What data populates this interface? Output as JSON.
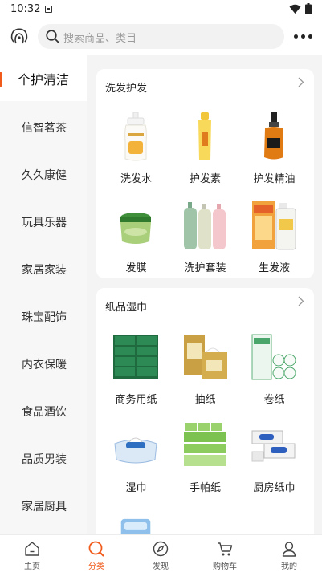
{
  "status": {
    "time": "10:32"
  },
  "search": {
    "placeholder": "搜索商品、类目"
  },
  "sidebar": {
    "items": [
      {
        "label": "个护清洁"
      },
      {
        "label": "信智茗茶"
      },
      {
        "label": "久久康健"
      },
      {
        "label": "玩具乐器"
      },
      {
        "label": "家居家装"
      },
      {
        "label": "珠宝配饰"
      },
      {
        "label": "内衣保暖"
      },
      {
        "label": "食品酒饮"
      },
      {
        "label": "品质男装"
      },
      {
        "label": "家居厨具"
      }
    ]
  },
  "sections": [
    {
      "title": "洗发护发",
      "products": [
        {
          "name": "洗发水"
        },
        {
          "name": "护发素"
        },
        {
          "name": "护发精油"
        },
        {
          "name": "发膜"
        },
        {
          "name": "洗护套装"
        },
        {
          "name": "生发液"
        }
      ]
    },
    {
      "title": "纸品湿巾",
      "products": [
        {
          "name": "商务用纸"
        },
        {
          "name": "抽纸"
        },
        {
          "name": "卷纸"
        },
        {
          "name": "湿巾"
        },
        {
          "name": "手帕纸"
        },
        {
          "name": "厨房纸巾"
        }
      ]
    }
  ],
  "tabs": [
    {
      "label": "主页",
      "icon": "home-icon"
    },
    {
      "label": "分类",
      "icon": "category-icon"
    },
    {
      "label": "发现",
      "icon": "compass-icon"
    },
    {
      "label": "购物车",
      "icon": "cart-icon"
    },
    {
      "label": "我的",
      "icon": "user-icon"
    }
  ],
  "colors": {
    "accent": "#f05a1a",
    "sidebar_bg": "#f7f7f7",
    "content_bg": "#f4f4f4"
  }
}
